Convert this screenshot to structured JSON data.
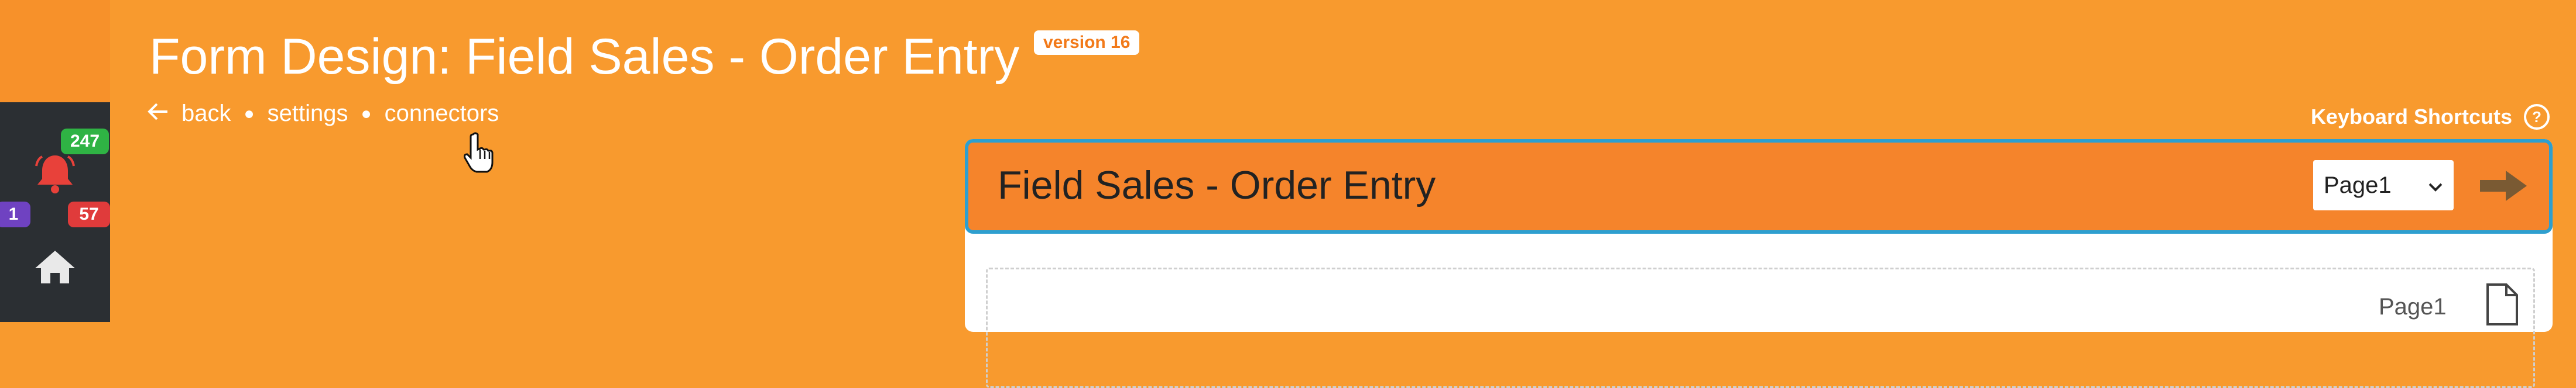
{
  "notifications": {
    "count_green": "247",
    "count_purple": "1",
    "count_red": "57"
  },
  "header": {
    "title": "Form Design: Field Sales - Order Entry",
    "version": "version 16"
  },
  "breadcrumb": {
    "back": "back",
    "separator": "●",
    "settings": "settings",
    "connectors": "connectors"
  },
  "shortcuts": {
    "label": "Keyboard Shortcuts",
    "help_glyph": "?"
  },
  "form": {
    "title": "Field Sales - Order Entry",
    "page_select": {
      "selected": "Page1",
      "options": [
        "Page1"
      ]
    },
    "page_label": "Page1"
  },
  "colors": {
    "background": "#f89a2e",
    "sidebar": "#2b2f33",
    "form_header": "#f5842b",
    "form_border": "#2e9fcf",
    "badge_green": "#2fb344",
    "badge_purple": "#6f42c1",
    "badge_red": "#e03b3b"
  },
  "icons": {
    "back": "arrow-left-icon",
    "bell": "bell-icon",
    "home": "home-icon",
    "help": "question-circle-icon",
    "next": "arrow-right-icon",
    "page": "document-icon",
    "cursor": "hand-pointer-icon"
  }
}
